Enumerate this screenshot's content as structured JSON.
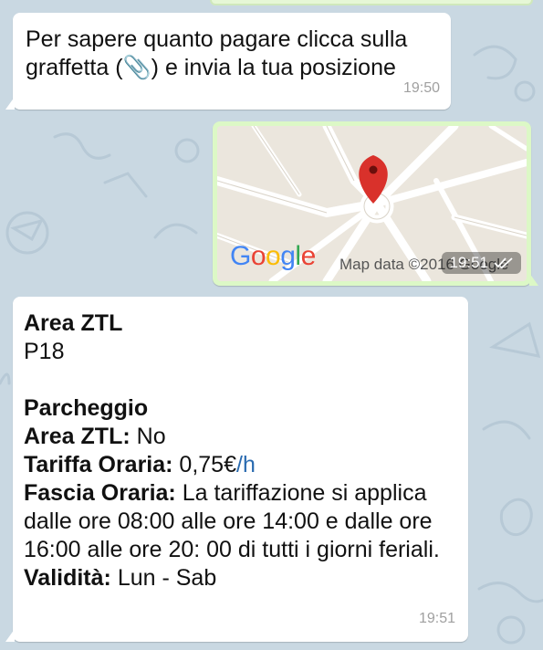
{
  "messages": {
    "m1": {
      "text": "Per sapere quanto pagare clicca sulla graffetta (📎) e invia la tua posizione",
      "time": "19:50"
    },
    "m2": {
      "logo": "Google",
      "map_credit": "Map data ©2016 Google",
      "time": "19:51",
      "status_icon": "double-check-icon"
    },
    "m3": {
      "area_title": "Area ZTL",
      "area_code": "P18",
      "section_title": "Parcheggio",
      "ztl_label": "Area ZTL:",
      "ztl_value": " No",
      "tariff_label": "Tariffa Oraria:",
      "tariff_value": " 0,75€",
      "tariff_unit": "/h",
      "band_label": "Fascia Oraria:",
      "band_value": " La tariffazione si applica dalle ore 08:00 alle ore 14:00 e dalle ore 16:00 alle ore 20: 00 di tutti i giorni feriali.",
      "validity_label": "Validità:",
      "validity_value": " Lun - Sab",
      "time": "19:51"
    }
  },
  "colors": {
    "wallpaper": "#c9d8e2",
    "incoming": "#ffffff",
    "outgoing": "#dcf8c6",
    "pin": "#d9312b",
    "link": "#2a6bb0"
  }
}
